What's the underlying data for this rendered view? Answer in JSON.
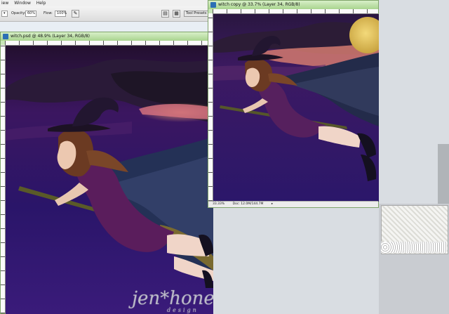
{
  "menu": {
    "items": [
      "iew",
      "Window",
      "Help"
    ]
  },
  "options": {
    "opacity_label": "Opacity:",
    "opacity_value": "60%",
    "flow_label": "Flow:",
    "flow_value": "100%",
    "tool_presets_label": "Tool Presets"
  },
  "window_main": {
    "title": "witch.psd @ 48.9% (Layer 34, RGB/8)"
  },
  "window_copy": {
    "title": "witch copy @ 33.7% (Layer 34, RGB/8)",
    "zoom": "33.33%",
    "doc_info": "Doc: 12.0M/144.7M"
  },
  "watermark": {
    "brand": "jen*honey",
    "sub": "design"
  },
  "colors": {
    "window_border": "#7fa46a",
    "sky_dark": "#2a0f52",
    "cloud_pink": "#e2758a",
    "moon": "#e8c65a",
    "dress": "#5a1d5c"
  }
}
